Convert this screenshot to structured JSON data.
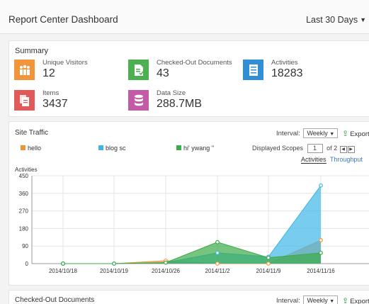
{
  "header": {
    "title": "Report Center Dashboard",
    "range_label": "Last 30 Days"
  },
  "summary": {
    "title": "Summary",
    "stats": [
      {
        "label": "Unique Visitors",
        "value": "12",
        "color": "#f0953a",
        "icon": "people-icon"
      },
      {
        "label": "Checked-Out Documents",
        "value": "43",
        "color": "#4caf50",
        "icon": "document-checkout-icon"
      },
      {
        "label": "Activities",
        "value": "18283",
        "color": "#2f8fd6",
        "icon": "activities-icon"
      },
      {
        "label": "Items",
        "value": "3437",
        "color": "#e05a5a",
        "icon": "items-icon"
      },
      {
        "label": "Data Size",
        "value": "288.7MB",
        "color": "#c35aa8",
        "icon": "database-icon"
      }
    ]
  },
  "site_traffic": {
    "title": "Site Traffic",
    "interval_label": "Interval:",
    "interval_value": "Weekly",
    "export_label": "Export",
    "displayed_scopes_label": "Displayed Scopes",
    "page_current": "1",
    "page_of": "of 2",
    "tabs": [
      "Activities",
      "Throughput"
    ],
    "y_label": "Activities"
  },
  "checked_out": {
    "title": "Checked-Out Documents",
    "interval_label": "Interval:",
    "interval_value": "Weekly",
    "export_label": "Export"
  },
  "chart_data": {
    "type": "area",
    "categories": [
      "",
      "2014/10/18",
      "2014/10/19",
      "2014/10/26",
      "2014/11/2",
      "2014/11/9",
      "2014/11/16"
    ],
    "ylabel": "Activities",
    "ylim": [
      0,
      450
    ],
    "yticks": [
      0,
      90,
      180,
      270,
      360,
      450
    ],
    "grid": true,
    "series": [
      {
        "name": "hello",
        "color": "#f0953a",
        "values": [
          0,
          0,
          0,
          15,
          0,
          0,
          120
        ]
      },
      {
        "name": "blog sc",
        "color": "#3fb6e6",
        "values": [
          0,
          0,
          0,
          5,
          55,
          35,
          400
        ]
      },
      {
        "name": "hi' ywang ''",
        "color": "#3cab4a",
        "values": [
          0,
          0,
          0,
          5,
          110,
          30,
          55
        ]
      }
    ]
  }
}
